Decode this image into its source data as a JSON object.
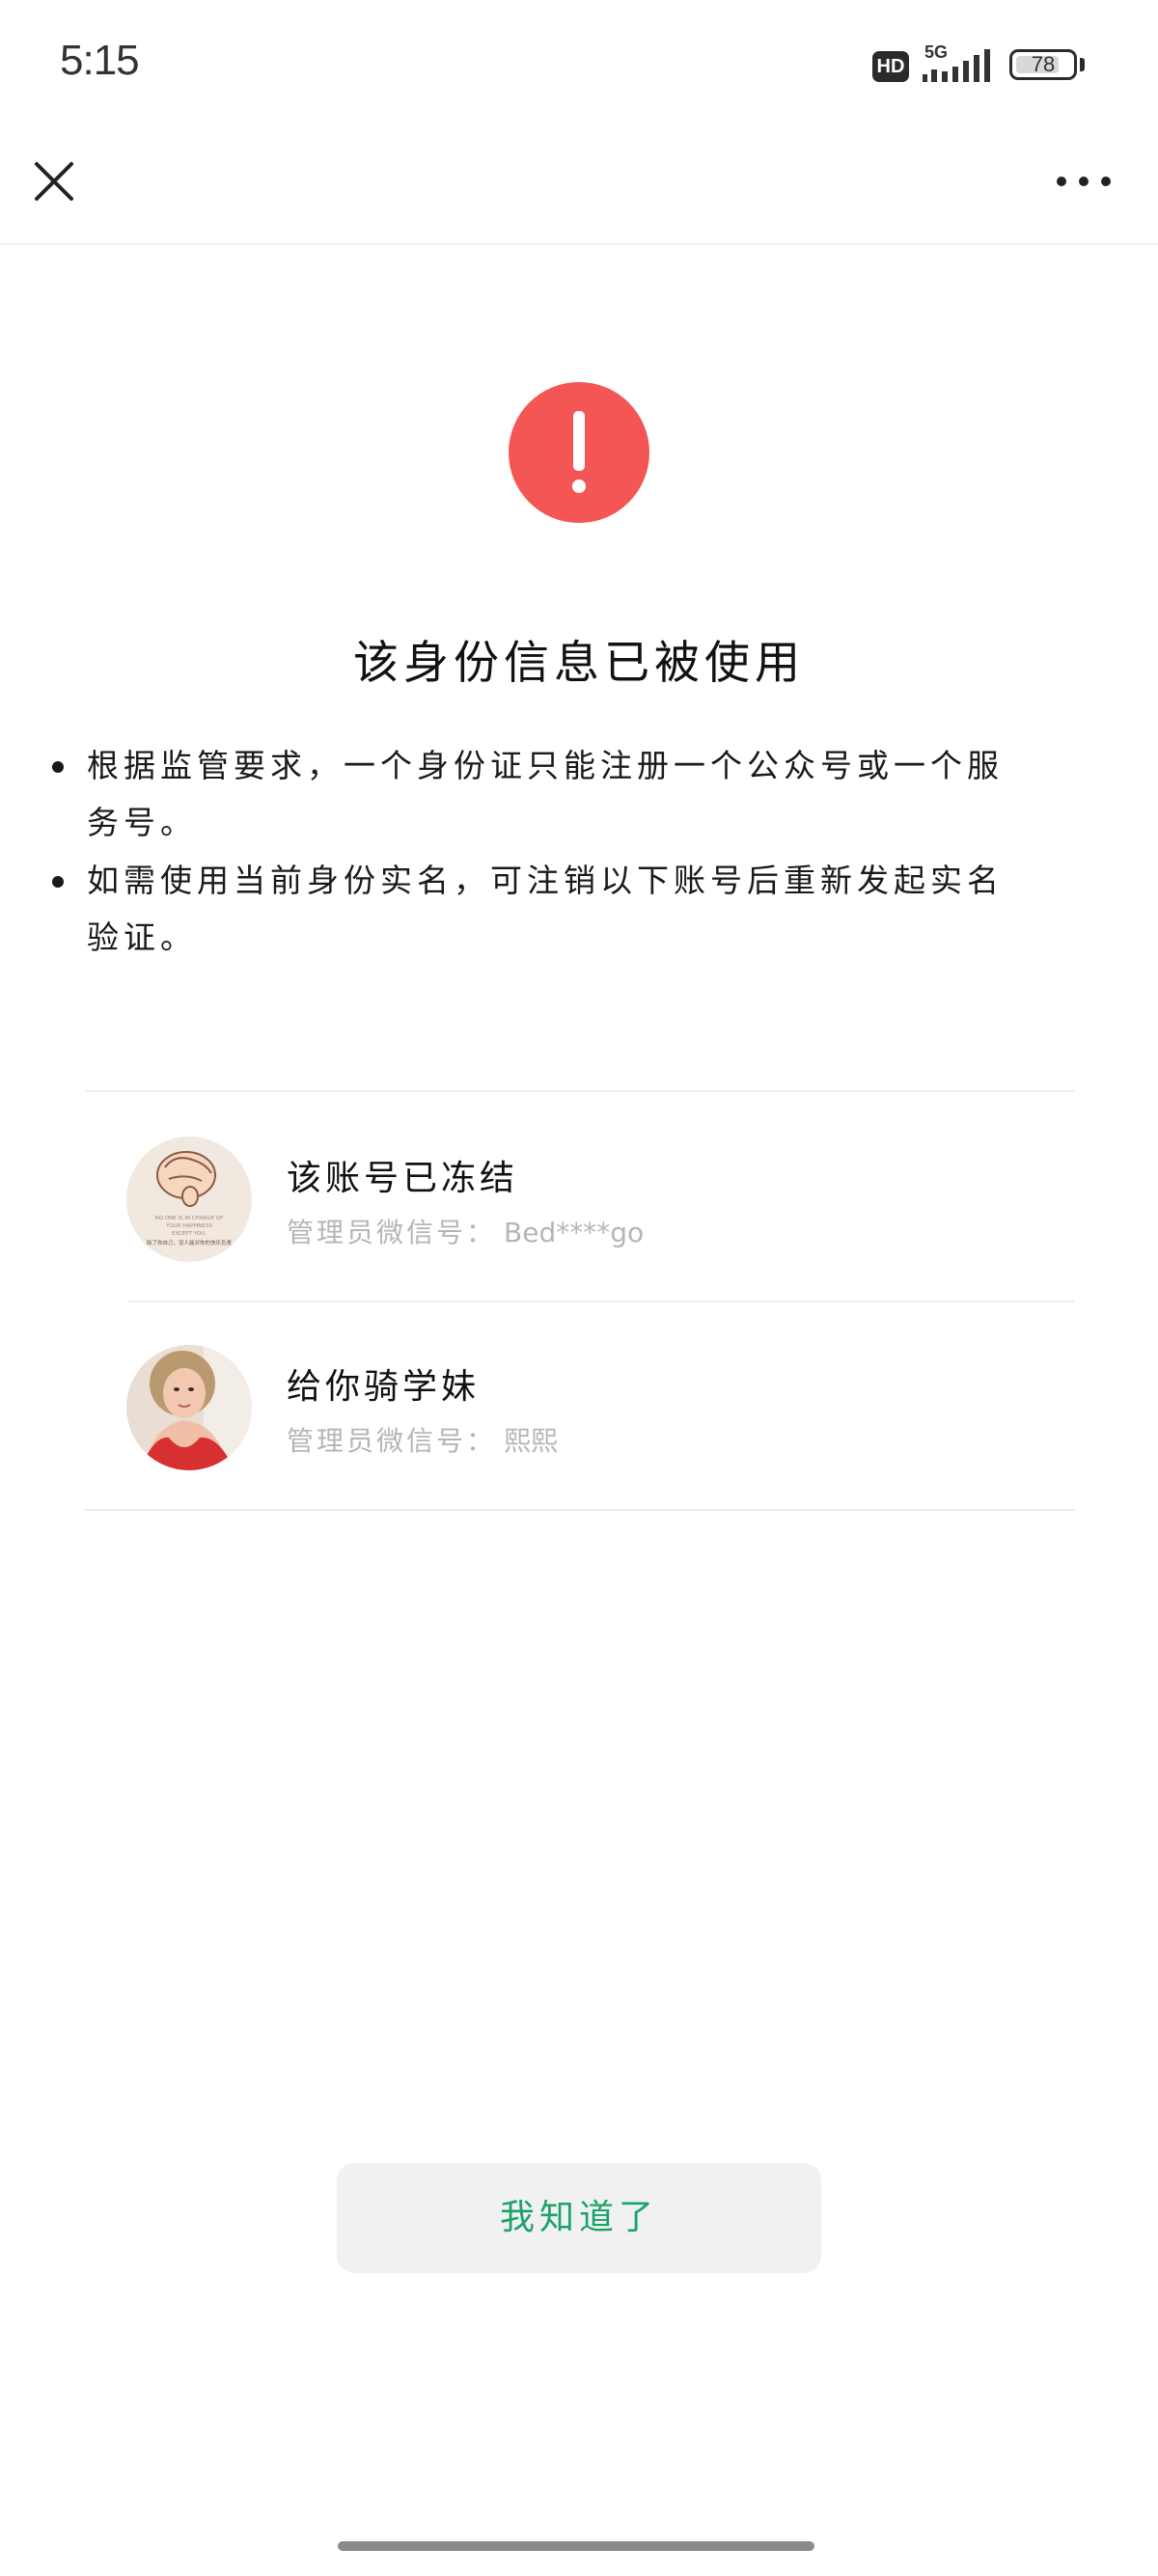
{
  "status_bar": {
    "time": "5:15",
    "hd": "HD",
    "network": "5G",
    "battery": "78",
    "battery_level": 0.78
  },
  "nav": {
    "close_icon": "close-icon",
    "more_icon": "more-horizontal-icon"
  },
  "alert": {
    "icon": "exclamation-icon",
    "color": "#f45555"
  },
  "page": {
    "title": "该身份信息已被使用",
    "notes": [
      "根据监管要求，一个身份证只能注册一个公众号或一个服务号。",
      "如需使用当前身份实名，可注销以下账号后重新发起实名验证。"
    ]
  },
  "accounts": [
    {
      "name": "该账号已冻结",
      "admin_label": "管理员微信号：",
      "admin_value": "Bed****go"
    },
    {
      "name": "给你骑学妹",
      "admin_label": "管理员微信号：",
      "admin_value": "熙熙"
    }
  ],
  "avatar_1_text": {
    "line1": "NO ONE IS IN CHARGE OF",
    "line2": "YOUR HAPPINESS",
    "line3": "EXCEPT YOU.",
    "line4": "除了你自己，没人能对你的快乐负责"
  },
  "confirm_button": "我知道了",
  "colors": {
    "accent_green": "#1aa36a",
    "alert_red": "#f45555",
    "muted_text": "#b5b5b5"
  }
}
